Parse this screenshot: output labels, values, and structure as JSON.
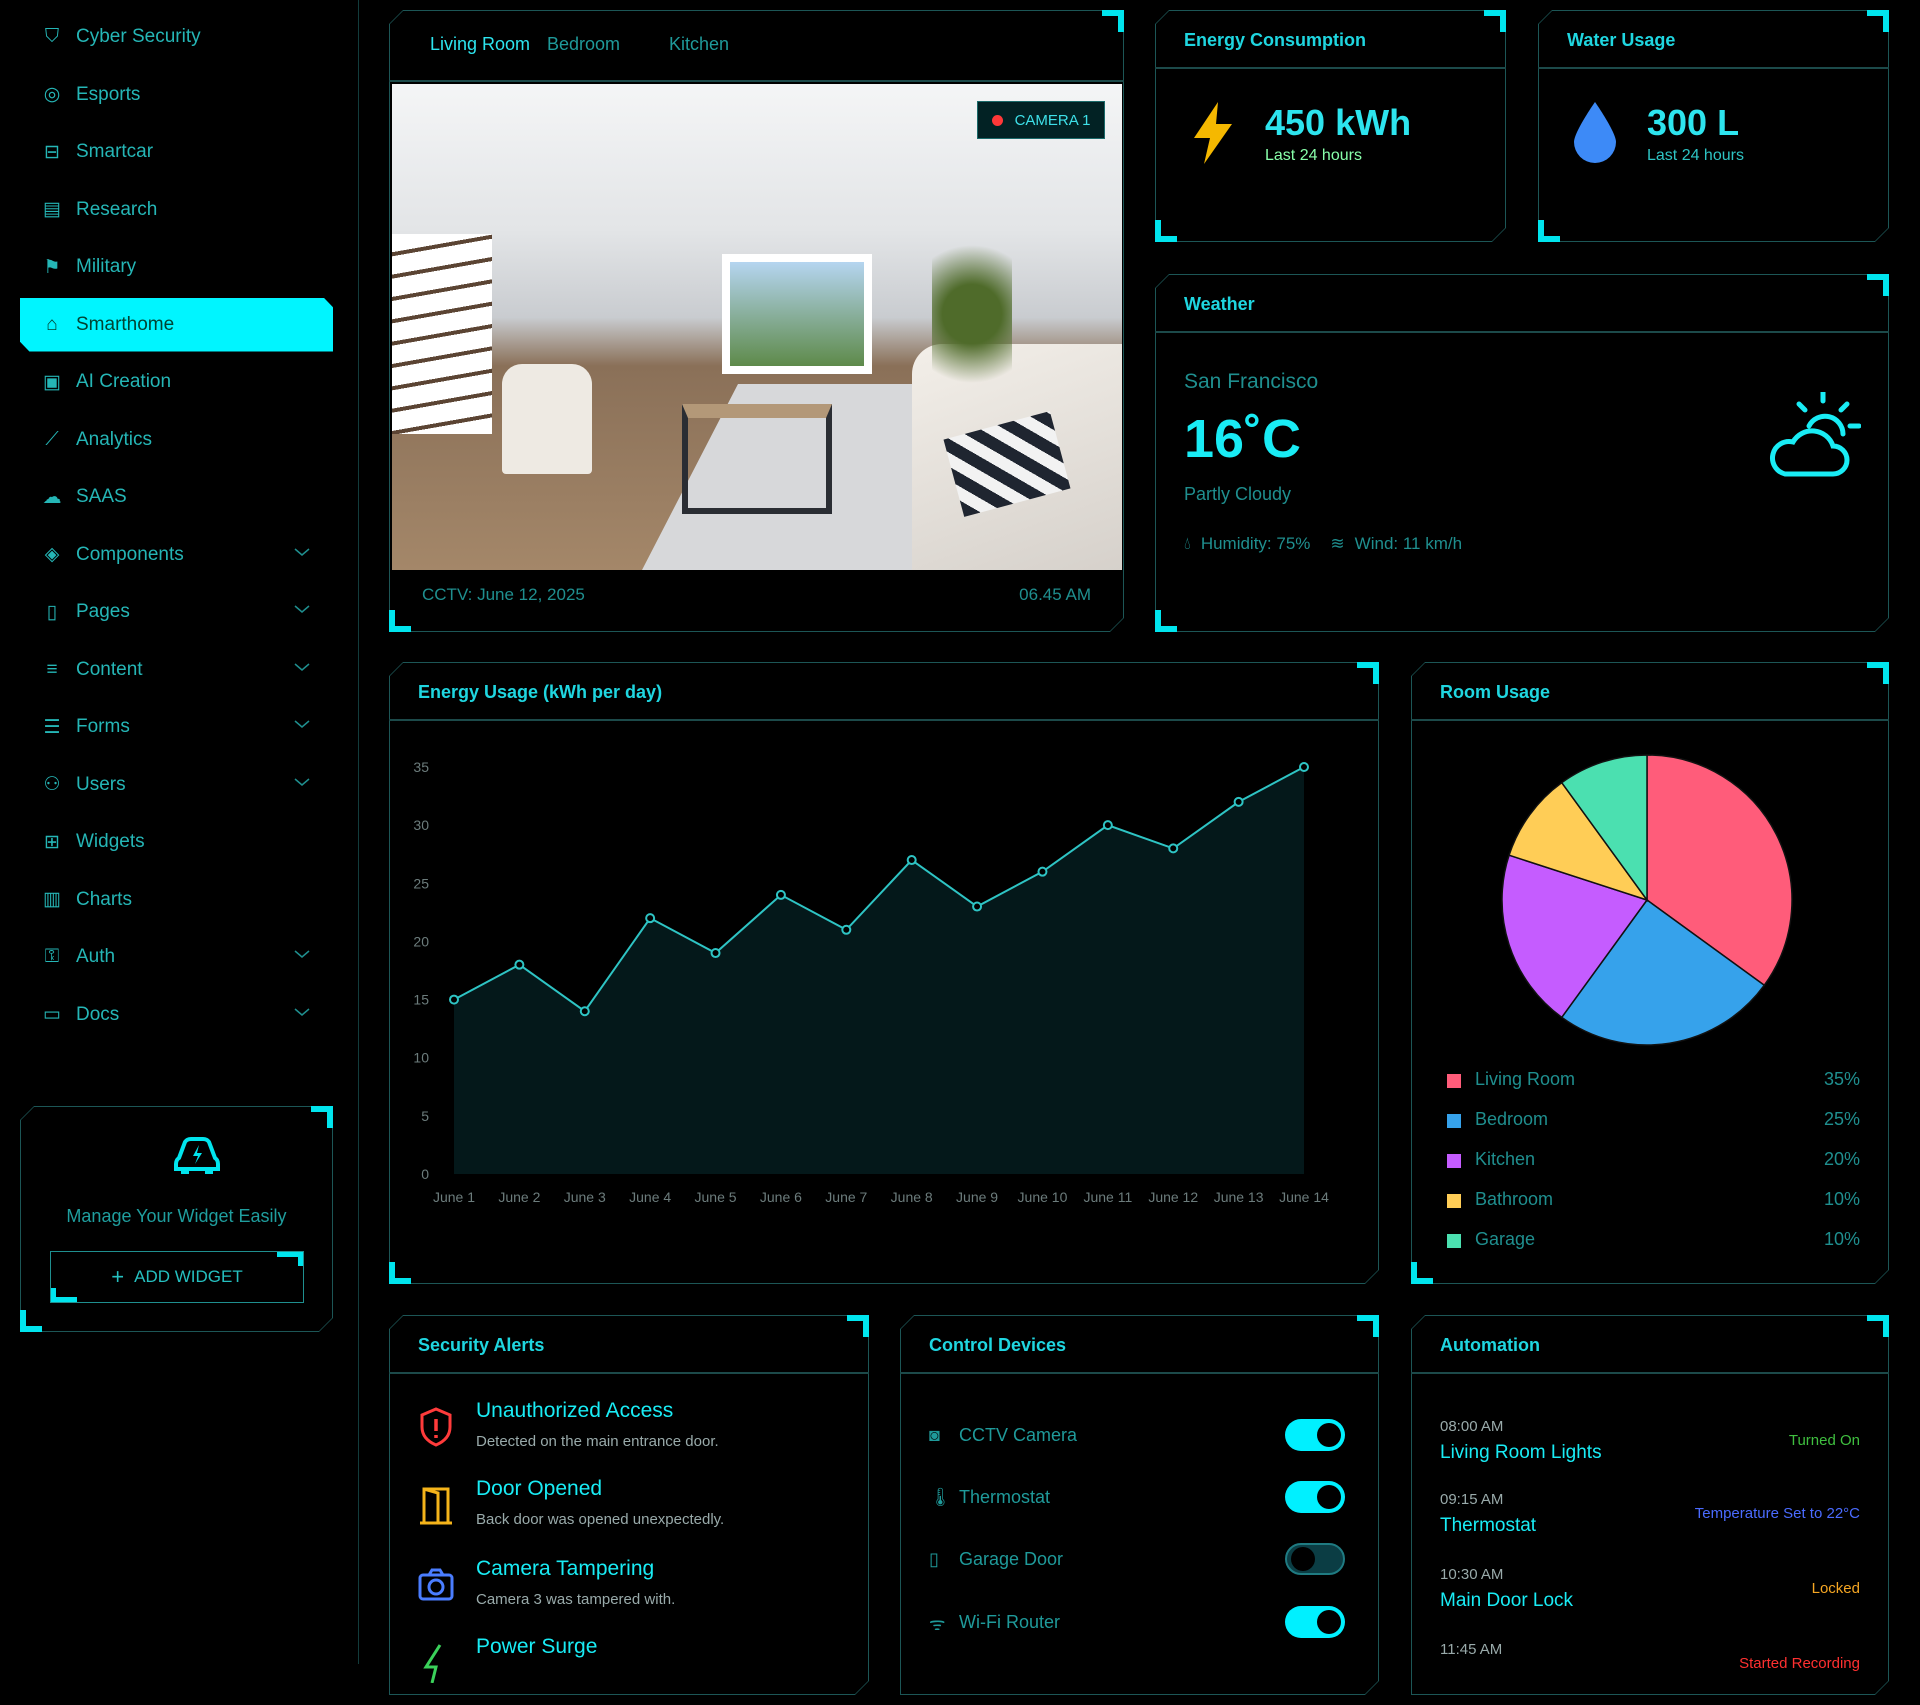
{
  "sidebar": {
    "items": [
      {
        "label": "Cyber Security",
        "icon": "shield-icon"
      },
      {
        "label": "Esports",
        "icon": "gamepad-icon"
      },
      {
        "label": "Smartcar",
        "icon": "car-icon"
      },
      {
        "label": "Research",
        "icon": "document-icon"
      },
      {
        "label": "Military",
        "icon": "badge-icon"
      },
      {
        "label": "Smarthome",
        "icon": "home-icon",
        "active": true
      },
      {
        "label": "AI Creation",
        "icon": "chip-icon"
      },
      {
        "label": "Analytics",
        "icon": "line-chart-icon"
      },
      {
        "label": "SAAS",
        "icon": "cloud-icon"
      },
      {
        "label": "Components",
        "icon": "layers-icon",
        "expandable": true
      },
      {
        "label": "Pages",
        "icon": "page-icon",
        "expandable": true
      },
      {
        "label": "Content",
        "icon": "lines-icon",
        "expandable": true
      },
      {
        "label": "Forms",
        "icon": "checklist-icon",
        "expandable": true
      },
      {
        "label": "Users",
        "icon": "users-icon",
        "expandable": true
      },
      {
        "label": "Widgets",
        "icon": "grid-icon"
      },
      {
        "label": "Charts",
        "icon": "bar-chart-icon"
      },
      {
        "label": "Auth",
        "icon": "key-icon",
        "expandable": true
      },
      {
        "label": "Docs",
        "icon": "book-icon",
        "expandable": true
      }
    ],
    "widget": {
      "text": "Manage Your Widget Easily",
      "button": "ADD WIDGET"
    }
  },
  "camera": {
    "tabs": [
      "Living Room",
      "Bedroom",
      "Kitchen"
    ],
    "active_tab": "Living Room",
    "badge": "CAMERA 1",
    "footer_left": "CCTV: June 12, 2025",
    "footer_right": "06.45 AM"
  },
  "energy": {
    "title": "Energy Consumption",
    "value": "450 kWh",
    "sub": "Last 24 hours"
  },
  "water": {
    "title": "Water Usage",
    "value": "300 L",
    "sub": "Last 24 hours"
  },
  "weather": {
    "title": "Weather",
    "city": "San Francisco",
    "temp": "16˚C",
    "condition": "Partly Cloudy",
    "humidity": "Humidity: 75%",
    "wind": "Wind: 11 km/h"
  },
  "chart_data": [
    {
      "type": "area",
      "title": "Energy Usage (kWh per day)",
      "categories": [
        "June 1",
        "June 2",
        "June 3",
        "June 4",
        "June 5",
        "June 6",
        "June 7",
        "June 8",
        "June 9",
        "June 10",
        "June 11",
        "June 12",
        "June 13",
        "June 14"
      ],
      "values": [
        15,
        18,
        14,
        22,
        19,
        24,
        21,
        27,
        23,
        26,
        30,
        28,
        32,
        35
      ],
      "yticks": [
        "0",
        "5",
        "10",
        "15",
        "20",
        "25",
        "30",
        "35"
      ],
      "ylim": [
        0,
        35
      ],
      "grid": false,
      "color": "#2ec4c4"
    },
    {
      "type": "pie",
      "title": "Room Usage",
      "categories": [
        "Living Room",
        "Bedroom",
        "Kitchen",
        "Bathroom",
        "Garage"
      ],
      "values": [
        35,
        25,
        20,
        10,
        10
      ],
      "labels": [
        "35%",
        "25%",
        "20%",
        "10%",
        "10%"
      ],
      "colors": [
        "#ff5c7a",
        "#36a2eb",
        "#c55cff",
        "#ffcd56",
        "#4be0b0"
      ],
      "legend": "bottom"
    }
  ],
  "security": {
    "title": "Security Alerts",
    "items": [
      {
        "title": "Unauthorized Access",
        "desc": "Detected on the main entrance door.",
        "icon": "shield-alert-icon",
        "color": "#ff3b3b"
      },
      {
        "title": "Door Opened",
        "desc": "Back door was opened unexpectedly.",
        "icon": "door-icon",
        "color": "#f5b41a"
      },
      {
        "title": "Camera Tampering",
        "desc": "Camera 3 was tampered with.",
        "icon": "camera-icon",
        "color": "#4a7dff"
      },
      {
        "title": "Power Surge",
        "desc": "",
        "icon": "bolt-icon",
        "color": "#3ad15a"
      }
    ]
  },
  "devices": {
    "title": "Control Devices",
    "items": [
      {
        "label": "CCTV Camera",
        "icon": "camera-icon",
        "on": true
      },
      {
        "label": "Thermostat",
        "icon": "thermometer-icon",
        "on": true
      },
      {
        "label": "Garage Door",
        "icon": "door-icon",
        "on": false
      },
      {
        "label": "Wi-Fi Router",
        "icon": "wifi-icon",
        "on": true
      }
    ]
  },
  "automation": {
    "title": "Automation",
    "items": [
      {
        "time": "08:00 AM",
        "name": "Living Room Lights",
        "status": "Turned On",
        "color": "#3fbf3f"
      },
      {
        "time": "09:15 AM",
        "name": "Thermostat",
        "status": "Temperature Set to 22°C",
        "color": "#4a6bff"
      },
      {
        "time": "10:30 AM",
        "name": "Main Door Lock",
        "status": "Locked",
        "color": "#f5a623"
      },
      {
        "time": "11:45 AM",
        "name": "",
        "status": "Started Recording",
        "color": "#ff3030"
      }
    ]
  }
}
